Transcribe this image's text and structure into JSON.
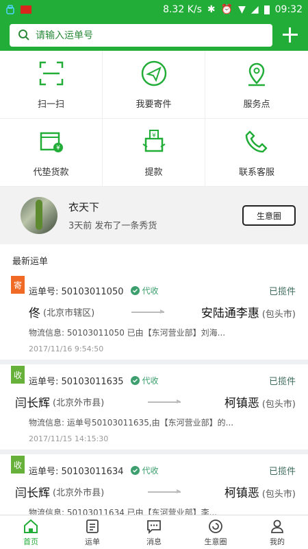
{
  "status_bar": {
    "speed": "8.32 K/s",
    "time": "09:32"
  },
  "search": {
    "placeholder": "请输入运单号"
  },
  "grid": [
    {
      "label": "扫一扫",
      "icon": "scan-icon"
    },
    {
      "label": "我要寄件",
      "icon": "send-icon"
    },
    {
      "label": "服务点",
      "icon": "location-pin-icon"
    },
    {
      "label": "代垫货款",
      "icon": "cod-box-icon"
    },
    {
      "label": "提款",
      "icon": "withdraw-icon"
    },
    {
      "label": "联系客服",
      "icon": "phone-icon"
    }
  ],
  "moment": {
    "name": "衣天下",
    "subtitle": "3天前 发布了一条秀货",
    "button": "生意圈"
  },
  "latest_title": "最新运单",
  "orders": [
    {
      "tag": "寄",
      "tag_color": "#f06a25",
      "number": "运单号: 50103011050",
      "cod": "代收",
      "status": "已揽件",
      "from_name": "佟",
      "from_city": "(北京市辖区)",
      "to_name": "安陆通李惠",
      "to_city": "(包头市)",
      "info": "物流信息: 50103011050 已由【东河营业部】刘海...",
      "time": "2017/11/16 9:54:50"
    },
    {
      "tag": "收",
      "tag_color": "#67b13a",
      "number": "运单号: 50103011635",
      "cod": "代收",
      "status": "已揽件",
      "from_name": "闫长辉",
      "from_city": "(北京外市县)",
      "to_name": "柯镇恶",
      "to_city": "(包头市)",
      "info": "物流信息: 运单号50103011635,由【东河营业部】的...",
      "time": "2017/11/15 14:15:30"
    },
    {
      "tag": "收",
      "tag_color": "#67b13a",
      "number": "运单号: 50103011634",
      "cod": "代收",
      "status": "已揽件",
      "from_name": "闫长辉",
      "from_city": "(北京外市县)",
      "to_name": "柯镇恶",
      "to_city": "(包头市)",
      "info": "物流信息: 50103011634 已由【东河营业部】李...",
      "time": ""
    }
  ],
  "tabs": [
    {
      "label": "首页",
      "icon": "home-icon",
      "active": true
    },
    {
      "label": "运单",
      "icon": "waybill-icon",
      "active": false
    },
    {
      "label": "消息",
      "icon": "message-icon",
      "active": false
    },
    {
      "label": "生意圈",
      "icon": "business-circle-icon",
      "active": false
    },
    {
      "label": "我的",
      "icon": "profile-icon",
      "active": false
    }
  ],
  "colors": {
    "brand_green": "#22ac38",
    "accent_teal": "#3c9f6d"
  }
}
